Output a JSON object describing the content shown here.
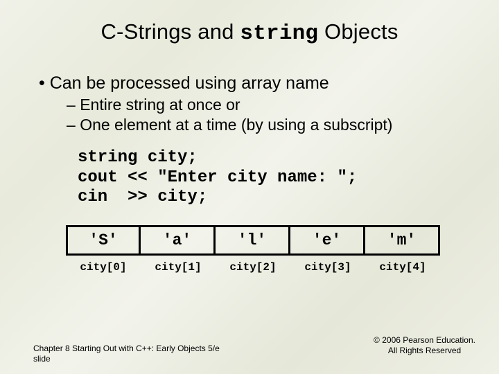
{
  "title": {
    "pre": "C-Strings and ",
    "code": "string",
    "post": " Objects"
  },
  "bullets": {
    "b1": "Can be processed using array name",
    "b2a": "Entire string at once or",
    "b2b": "One element at a time (by using a subscript)"
  },
  "code": "string city;\ncout << \"Enter city name: \";\ncin  >> city;",
  "cells": {
    "c0": {
      "val": "'S'",
      "idx": "city[0]"
    },
    "c1": {
      "val": "'a'",
      "idx": "city[1]"
    },
    "c2": {
      "val": "'l'",
      "idx": "city[2]"
    },
    "c3": {
      "val": "'e'",
      "idx": "city[3]"
    },
    "c4": {
      "val": "'m'",
      "idx": "city[4]"
    }
  },
  "footer": {
    "left1": "Chapter 8 Starting Out with C++: Early Objects 5/e",
    "left2": "slide",
    "right1": "© 2006 Pearson Education.",
    "right2": "All Rights Reserved"
  }
}
